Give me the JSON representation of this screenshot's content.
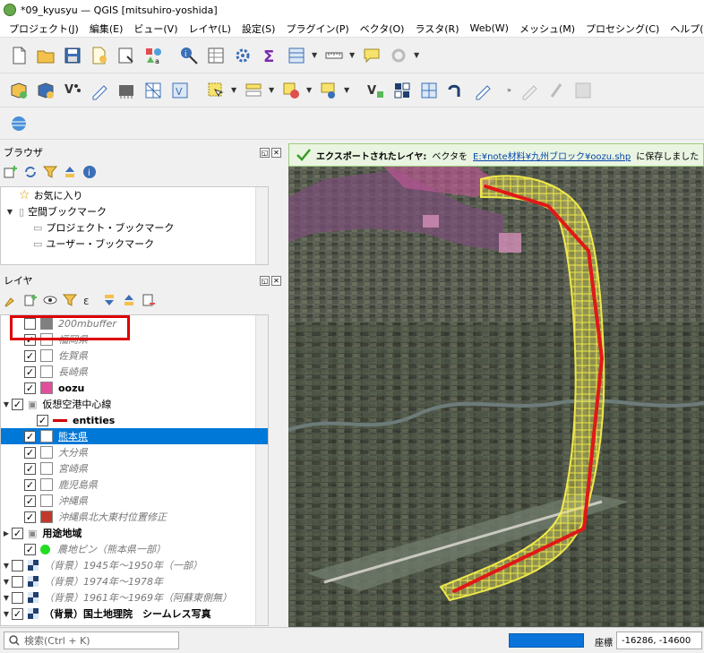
{
  "window": {
    "title": "*09_kyusyu — QGIS [mitsuhiro-yoshida]"
  },
  "menu": [
    "プロジェクト(J)",
    "編集(E)",
    "ビュー(V)",
    "レイヤ(L)",
    "設定(S)",
    "プラグイン(P)",
    "ベクタ(O)",
    "ラスタ(R)",
    "Web(W)",
    "メッシュ(M)",
    "プロセシング(C)",
    "ヘルプ(H)"
  ],
  "browser": {
    "title": "ブラウザ",
    "items": [
      {
        "label": "お気に入り",
        "icon": "star-icon",
        "indent": 0
      },
      {
        "label": "空間ブックマーク",
        "icon": "bookmark-icon",
        "indent": 0,
        "expanded": true
      },
      {
        "label": "プロジェクト・ブックマーク",
        "icon": "folder-icon",
        "indent": 1
      },
      {
        "label": "ユーザー・ブックマーク",
        "icon": "folder-icon",
        "indent": 1
      }
    ]
  },
  "layers": {
    "title": "レイヤ",
    "items": [
      {
        "name": "200mbuffer",
        "checked": false,
        "color": "#808080",
        "style": "italic",
        "indent": 1
      },
      {
        "name": "福岡県",
        "checked": true,
        "color": "#ffffff",
        "style": "italic",
        "indent": 1
      },
      {
        "name": "佐賀県",
        "checked": true,
        "color": "#ffffff",
        "style": "italic",
        "indent": 1
      },
      {
        "name": "長崎県",
        "checked": true,
        "color": "#ffffff",
        "style": "italic",
        "indent": 1
      },
      {
        "name": "oozu",
        "checked": true,
        "color": "#e04f9a",
        "style": "bold",
        "indent": 1
      },
      {
        "name": "仮想空港中心線",
        "checked": true,
        "group": true,
        "expanded": true,
        "indent": 0
      },
      {
        "name": "entities",
        "checked": true,
        "line": "#d00000",
        "style": "bold",
        "indent": 2
      },
      {
        "name": "熊本県",
        "checked": true,
        "color": "#ffffff",
        "style": "selected",
        "indent": 1
      },
      {
        "name": "大分県",
        "checked": true,
        "color": "#ffffff",
        "style": "italic",
        "indent": 1
      },
      {
        "name": "宮崎県",
        "checked": true,
        "color": "#ffffff",
        "style": "italic",
        "indent": 1
      },
      {
        "name": "鹿児島県",
        "checked": true,
        "color": "#ffffff",
        "style": "italic",
        "indent": 1
      },
      {
        "name": "沖縄県",
        "checked": true,
        "color": "#ffffff",
        "style": "italic",
        "indent": 1
      },
      {
        "name": "沖縄県北大東村位置修正",
        "checked": true,
        "color": "#c0392b",
        "style": "italic",
        "indent": 1
      },
      {
        "name": "用途地域",
        "checked": true,
        "group": true,
        "expanded": false,
        "style": "bold",
        "indent": 0
      },
      {
        "name": "農地ピン（熊本県一部）",
        "checked": true,
        "dot": "#22dd22",
        "style": "italic",
        "indent": 1
      },
      {
        "name": "（背景）1945年～1950年（一部）",
        "checked": false,
        "raster": true,
        "style": "italic",
        "indent": 0
      },
      {
        "name": "（背景）1974年～1978年",
        "checked": false,
        "raster": true,
        "style": "italic",
        "indent": 0
      },
      {
        "name": "（背景）1961年～1969年（阿蘇東側無）",
        "checked": false,
        "raster": true,
        "style": "italic",
        "indent": 0
      },
      {
        "name": "（背景）国土地理院　シームレス写真",
        "checked": true,
        "raster": true,
        "style": "bold",
        "indent": 0
      }
    ]
  },
  "message": {
    "title": "エクスポートされたレイヤ:",
    "prefix": "ベクタを",
    "path": "E:¥note材料¥九州ブロック¥oozu.shp",
    "suffix": "に保存しました"
  },
  "status": {
    "search_placeholder": "検索(Ctrl + K)",
    "coord_label": "座標",
    "coord_value": "-16286, -14600"
  }
}
